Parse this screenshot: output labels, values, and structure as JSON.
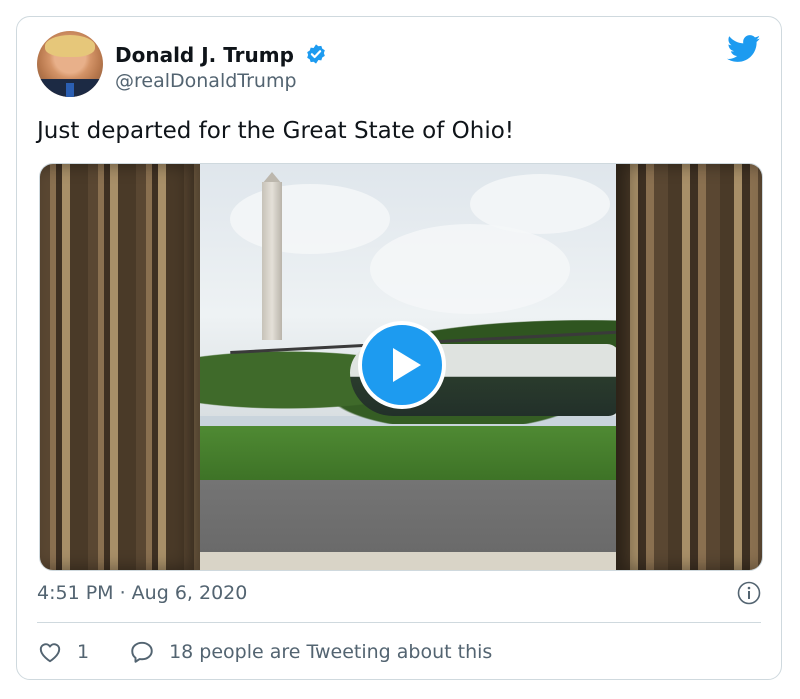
{
  "author": {
    "name": "Donald J. Trump",
    "handle": "@realDonaldTrump",
    "verified_icon": "verified-badge-icon",
    "avatar": "profile-avatar"
  },
  "brand": {
    "icon": "twitter-bird-icon",
    "color": "#1d9bf0"
  },
  "tweet": {
    "text": "Just departed for the Great State of Ohio!",
    "media": {
      "type": "video",
      "play_icon": "play-icon"
    },
    "timestamp": "4:51 PM · Aug 6, 2020"
  },
  "actions": {
    "like": {
      "icon": "heart-icon",
      "count": "1"
    },
    "conversation": {
      "icon": "speech-bubble-icon",
      "label": "18 people are Tweeting about this"
    },
    "info_icon": "info-icon"
  },
  "colors": {
    "text_primary": "#0f1419",
    "text_secondary": "#536471",
    "border": "#cfd9de",
    "accent": "#1d9bf0"
  }
}
